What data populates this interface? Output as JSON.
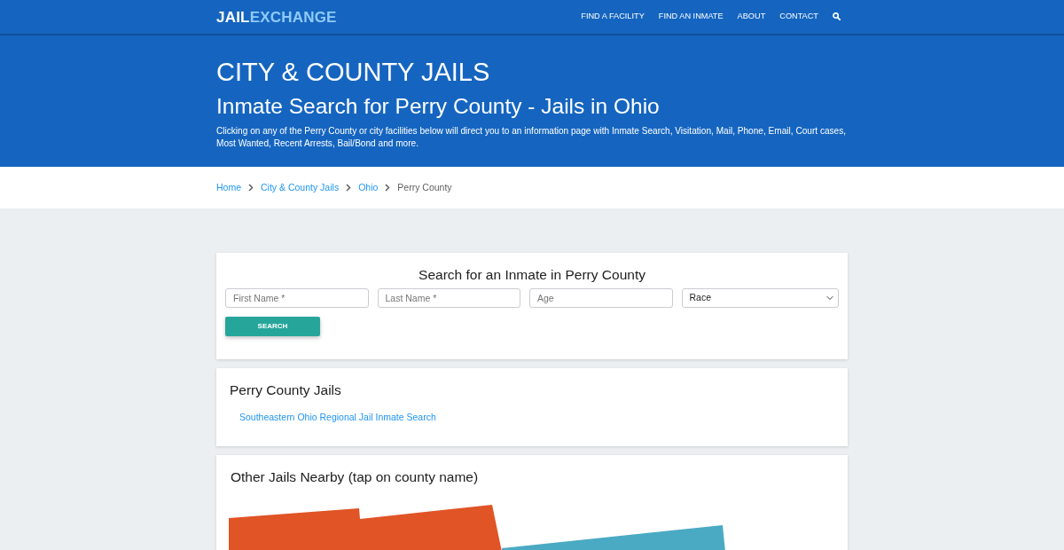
{
  "navbar": {
    "logo": {
      "part_1": "JAIL",
      "part_2": "EXCHANGE"
    },
    "links": [
      "FIND A FACILITY",
      "FIND AN INMATE",
      "ABOUT",
      "CONTACT"
    ]
  },
  "header": {
    "category": "CITY & COUNTY JAILS",
    "title": "Inmate Search for Perry County - Jails in Ohio",
    "description": "Clicking on any of the Perry County or city facilities below will direct you to an information page with Inmate Search, Visitation, Mail, Phone, Email, Court cases, Most Wanted, Recent Arrests, Bail/Bond and more."
  },
  "breadcrumb": [
    {
      "label": "Home",
      "current": false
    },
    {
      "label": "City & County Jails",
      "current": false
    },
    {
      "label": "Ohio",
      "current": false
    },
    {
      "label": "Perry County",
      "current": true
    }
  ],
  "search_form": {
    "title": "Search for an Inmate in Perry County",
    "fields": [
      {
        "kind": "input",
        "placeholder": "First Name *"
      },
      {
        "kind": "input",
        "placeholder": "Last Name *"
      },
      {
        "kind": "input",
        "placeholder": "Age"
      },
      {
        "kind": "select",
        "value": "Race"
      }
    ],
    "button": "SEARCH"
  },
  "jails": {
    "title": "Perry County Jails",
    "links": [
      "Southeastern Ohio Regional Jail Inmate Search"
    ]
  },
  "nearby": {
    "title": "Other Jails Nearby (tap on county name)"
  }
}
